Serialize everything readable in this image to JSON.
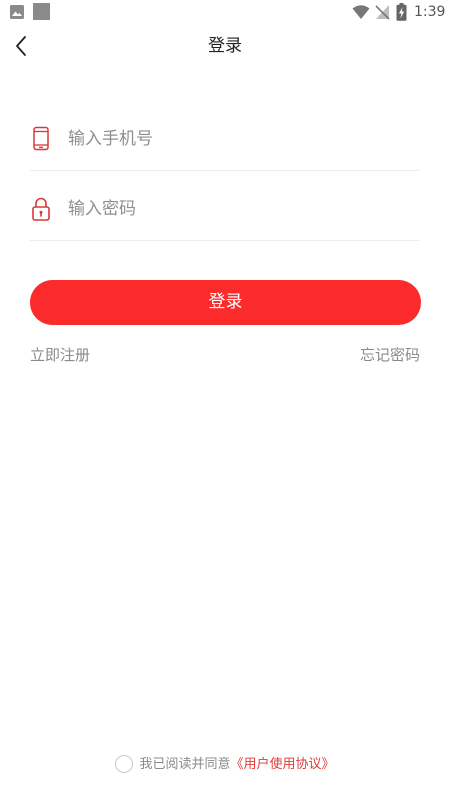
{
  "status_bar": {
    "time": "1:39",
    "icons": [
      "image-icon",
      "app-square-icon",
      "wifi-icon",
      "no-signal-icon",
      "battery-charging-icon"
    ]
  },
  "nav": {
    "title": "登录",
    "back_icon": "chevron-left-icon"
  },
  "form": {
    "phone": {
      "placeholder": "输入手机号",
      "value": "",
      "icon": "mobile-phone-icon"
    },
    "password": {
      "placeholder": "输入密码",
      "value": "",
      "icon": "lock-icon"
    },
    "login_label": "登录",
    "register_label": "立即注册",
    "forgot_label": "忘记密码"
  },
  "agreement": {
    "text": "我已阅读并同意",
    "link": "《用户使用协议》",
    "checked": false
  },
  "colors": {
    "accent": "#fb2b2b",
    "icon_red": "#d9383a",
    "muted_text": "#8a8a8a",
    "divider": "#ededed"
  }
}
